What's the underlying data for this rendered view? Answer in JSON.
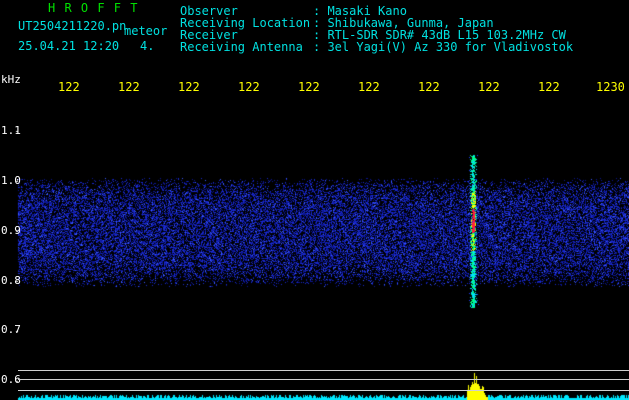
{
  "header": {
    "station_name": "H R O F F T",
    "filename": "UT2504211220.pn",
    "meteor_label": "meteor",
    "datetime": "25.04.21 12:20",
    "page_indicator": "4.",
    "info_labels": [
      "Observer",
      "Receiving Location",
      "Receiver",
      "Receiving Antenna"
    ],
    "info_values": [
      ": Masaki Kano",
      ": Shibukawa, Gunma, Japan",
      ": RTL-SDR SDR# 43dB L15 103.2MHz CW",
      ": 3el Yagi(V) Az 330 for Vladivostok"
    ]
  },
  "axes": {
    "y_unit": "kHz",
    "y_ticks": [
      "1.1",
      "1.0",
      "0.9",
      "0.8",
      "0.7",
      "0.6"
    ],
    "x_ticks": [
      "122",
      "122",
      "122",
      "122",
      "122",
      "122",
      "122",
      "122",
      "122",
      "1230"
    ]
  },
  "colors": {
    "header_green": "#00e000",
    "header_cyan": "#00e0e0",
    "tick_yellow": "#ffff00",
    "noise_blue": "#1020a0",
    "echo_red": "#ff2040",
    "echo_green": "#00ff80",
    "echo_yellow": "#ffff00",
    "level_cyan": "#00ffff"
  },
  "chart_data": {
    "type": "heatmap",
    "title": "",
    "xlabel": "",
    "ylabel": "kHz",
    "ylim": [
      0.58,
      1.14
    ],
    "noise_band": [
      0.8,
      1.0
    ],
    "echo": {
      "x_minutes": 7.9,
      "freq_range": [
        0.77,
        1.05
      ],
      "peak_freq": 0.92
    }
  }
}
